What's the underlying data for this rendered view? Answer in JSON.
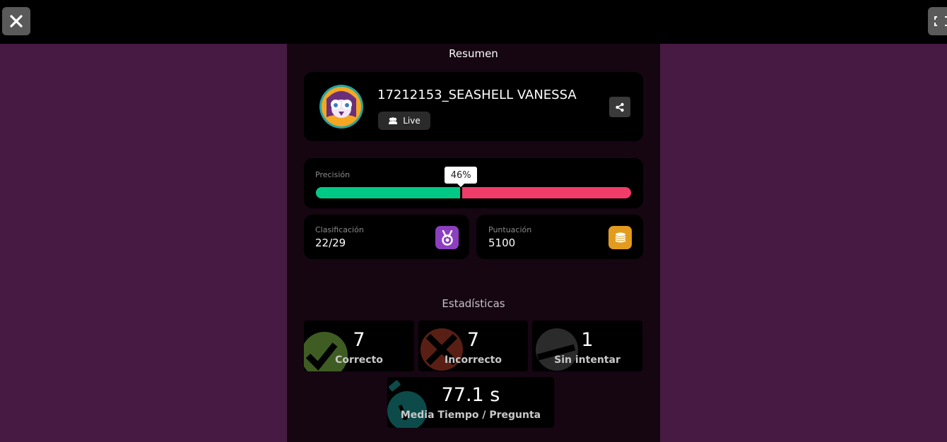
{
  "summary": {
    "title": "Resumen"
  },
  "player": {
    "name": "17212153_SEASHELL VANESSA",
    "mode_label": "Live"
  },
  "accuracy": {
    "label": "Precisión",
    "percent_label": "46%",
    "percent": 46,
    "correct_color": "#00c985",
    "incorrect_color": "#ef3c69"
  },
  "rank": {
    "label": "Clasificación",
    "value": "22/29",
    "icon": "medal-icon",
    "icon_color": "#8c3fbe"
  },
  "score": {
    "label": "Puntuación",
    "value": "5100",
    "icon": "coins-icon",
    "icon_color": "#e39b1e"
  },
  "stats": {
    "title": "Estadísticas",
    "correct": {
      "value": "7",
      "label": "Correcto",
      "icon": "check-icon",
      "color": "#3f5d22"
    },
    "incorrect": {
      "value": "7",
      "label": "Incorrecto",
      "icon": "cross-icon",
      "color": "#5a1f14"
    },
    "unattempted": {
      "value": "1",
      "label": "Sin intentar",
      "icon": "minus-icon",
      "color": "#2b2b2b"
    },
    "avg_time": {
      "value": "77.1 s",
      "label": "Media Tiempo / Pregunta",
      "icon": "stopwatch-icon",
      "color": "#0c4b4a"
    }
  }
}
